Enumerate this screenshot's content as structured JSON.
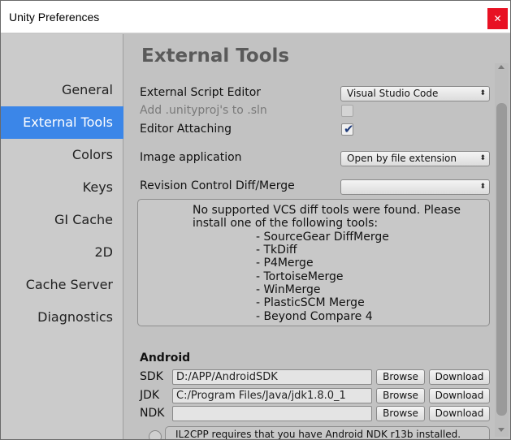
{
  "window": {
    "title": "Unity Preferences",
    "close_glyph": "✕"
  },
  "sidebar": {
    "items": [
      {
        "label": "General"
      },
      {
        "label": "External Tools"
      },
      {
        "label": "Colors"
      },
      {
        "label": "Keys"
      },
      {
        "label": "GI Cache"
      },
      {
        "label": "2D"
      },
      {
        "label": "Cache Server"
      },
      {
        "label": "Diagnostics"
      }
    ],
    "active_index": 1
  },
  "main": {
    "heading": "External Tools",
    "external_script_editor": {
      "label": "External Script Editor",
      "value": "Visual Studio Code"
    },
    "add_unityproj": {
      "label": "Add .unityproj's to .sln",
      "checked": false,
      "enabled": false
    },
    "editor_attaching": {
      "label": "Editor Attaching",
      "checked": true,
      "check_glyph": "✔"
    },
    "image_application": {
      "label": "Image application",
      "value": "Open by file extension"
    },
    "revision_control": {
      "label": "Revision Control Diff/Merge",
      "value": ""
    },
    "dropdown_arrow": "⬍",
    "vcs_help": {
      "lines": [
        "No supported VCS diff tools were found. Please",
        "install one of the following tools:",
        "- SourceGear DiffMerge",
        "- TkDiff",
        "- P4Merge",
        "- TortoiseMerge",
        "- WinMerge",
        "- PlasticSCM Merge",
        "- Beyond Compare 4"
      ]
    },
    "android": {
      "title": "Android",
      "sdk": {
        "label": "SDK",
        "value": "D:/APP/AndroidSDK"
      },
      "jdk": {
        "label": "JDK",
        "value": "C:/Program Files/Java/jdk1.8.0_1"
      },
      "ndk": {
        "label": "NDK",
        "value": ""
      },
      "browse_label": "Browse",
      "download_label": "Download",
      "il2cpp_note": "IL2CPP requires that you have Android NDK r13b installed."
    }
  },
  "colors": {
    "selection": "#3b86e8",
    "close": "#e81123"
  }
}
